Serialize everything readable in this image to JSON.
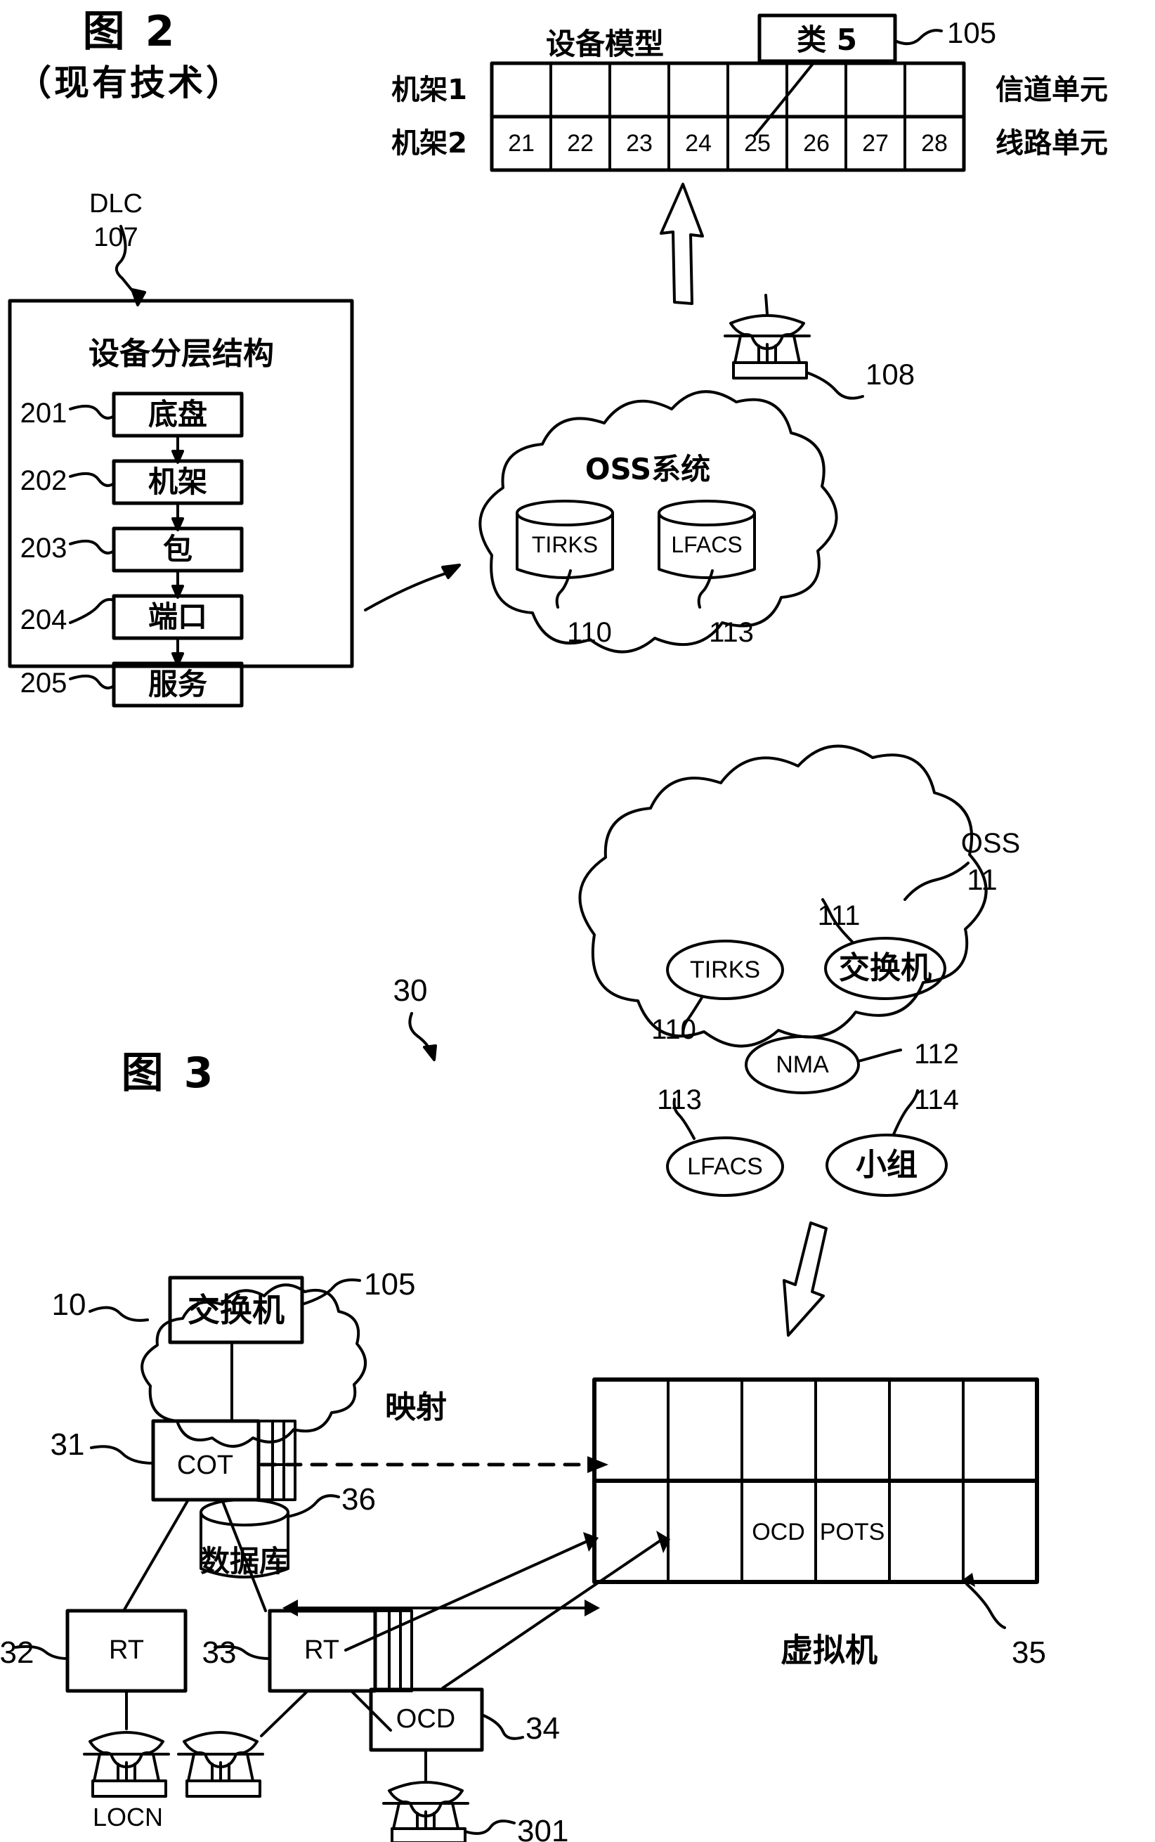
{
  "figures": [
    {
      "id": "fig2",
      "title": "图 2",
      "subtitle": "（现有技术）"
    },
    {
      "id": "fig3",
      "title": "图 3",
      "pointer_ref": "30"
    }
  ],
  "fig2": {
    "title": "图 2",
    "subtitle": "（现有技术）",
    "class_box": {
      "label": "类 5",
      "ref": "105"
    },
    "equipment_model": {
      "title": "设备模型",
      "row_labels": [
        "机架1",
        "机架2"
      ],
      "right_labels": [
        "信道单元",
        "线路单元"
      ],
      "rows": [
        [
          "",
          "",
          "",
          "",
          "",
          "",
          "",
          ""
        ],
        [
          "21",
          "22",
          "23",
          "24",
          "25",
          "26",
          "27",
          "28"
        ]
      ],
      "columns": 8
    },
    "telephone": {
      "name": "telephone",
      "ref": "108"
    },
    "dlc": {
      "label": "DLC",
      "ref": "107",
      "panel_title": "设备分层结构",
      "hierarchy": [
        {
          "ref": "201",
          "label": "底盘"
        },
        {
          "ref": "202",
          "label": "机架"
        },
        {
          "ref": "203",
          "label": "包"
        },
        {
          "ref": "204",
          "label": "端口"
        },
        {
          "ref": "205",
          "label": "服务"
        }
      ]
    },
    "oss_cloud": {
      "title": "OSS系统",
      "databases": [
        {
          "label": "TIRKS",
          "ref": "110"
        },
        {
          "label": "LFACS",
          "ref": "113"
        }
      ]
    }
  },
  "fig3": {
    "title": "图 3",
    "pointer_ref": "30",
    "oss_cloud": {
      "label": "OSS",
      "ref": "11",
      "nodes": [
        {
          "label": "TIRKS",
          "ref": "110"
        },
        {
          "label": "交换机",
          "ref": "111"
        },
        {
          "label": "NMA",
          "ref": "112"
        },
        {
          "label": "LFACS",
          "ref": "113"
        },
        {
          "label": "小组",
          "ref": "114"
        }
      ]
    },
    "switch_cloud": {
      "cloud_ref": "10",
      "box_label": "交换机",
      "box_ref": "105"
    },
    "cot": {
      "label": "COT",
      "ref": "31"
    },
    "mapping_label": "映射",
    "database": {
      "label": "数据库",
      "ref": "36"
    },
    "virtual_machine": {
      "label": "虚拟机",
      "ref": "35",
      "columns": 6,
      "rows": [
        [
          "",
          "",
          "",
          "",
          "",
          ""
        ],
        [
          "",
          "OCD",
          "POTS",
          "",
          "",
          ""
        ]
      ]
    },
    "remote_terminals": [
      {
        "label": "RT",
        "ref": "32",
        "phone_label": "LOCN"
      },
      {
        "label": "RT",
        "ref": "33"
      }
    ],
    "ocd": {
      "label": "OCD",
      "ref": "34"
    },
    "ocd_phone": {
      "ref": "301"
    }
  },
  "colors": {
    "ink": "#000000",
    "paper": "#ffffff"
  }
}
